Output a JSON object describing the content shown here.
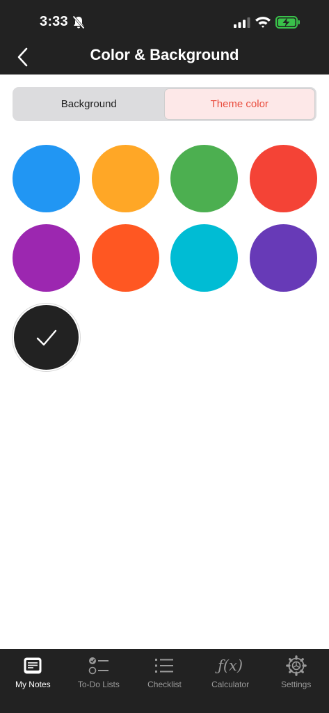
{
  "status": {
    "time": "3:33"
  },
  "nav": {
    "title": "Color & Background"
  },
  "segment": {
    "tabs": [
      {
        "label": "Background"
      },
      {
        "label": "Theme color"
      }
    ],
    "active_index": 1
  },
  "colors": {
    "accent": "#e94c3d",
    "swatches": [
      "#2196f3",
      "#ffa726",
      "#4caf50",
      "#f44336",
      "#9c27b0",
      "#ff5722",
      "#00bcd4",
      "#673ab7",
      "#222222"
    ],
    "selected_index": 8
  },
  "tabbar": {
    "items": [
      {
        "label": "My Notes",
        "icon": "notes-icon"
      },
      {
        "label": "To-Do Lists",
        "icon": "todo-list-icon"
      },
      {
        "label": "Checklist",
        "icon": "checklist-icon"
      },
      {
        "label": "Calculator",
        "icon": "fx-icon",
        "glyph": "ƒ(x)"
      },
      {
        "label": "Settings",
        "icon": "gear-icon"
      }
    ],
    "active_index": 0
  }
}
